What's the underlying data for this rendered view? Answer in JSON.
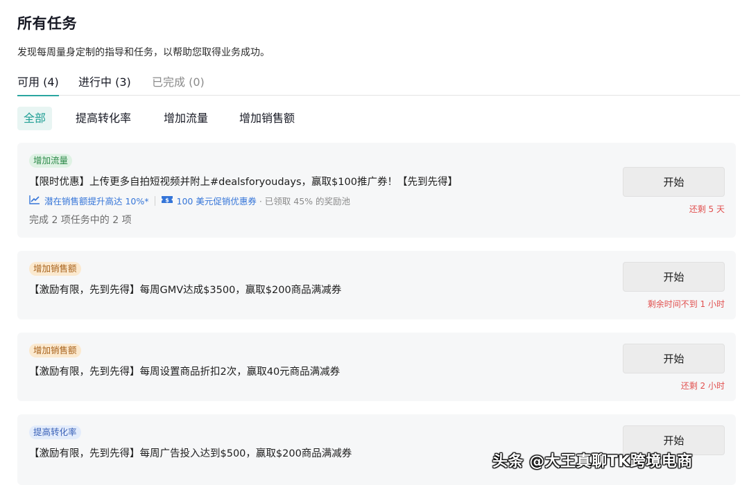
{
  "page": {
    "title": "所有任务",
    "subtitle": "发现每周量身定制的指导和任务，以帮助您取得业务成功。"
  },
  "status_tabs": [
    {
      "label": "可用 (4)",
      "state": "active"
    },
    {
      "label": "进行中 (3)",
      "state": "normal"
    },
    {
      "label": "已完成 (0)",
      "state": "muted"
    }
  ],
  "filters": [
    {
      "label": "全部",
      "active": true
    },
    {
      "label": "提高转化率",
      "active": false
    },
    {
      "label": "增加流量",
      "active": false
    },
    {
      "label": "增加销售额",
      "active": false
    }
  ],
  "tasks": [
    {
      "tag": "增加流量",
      "tag_color": "green",
      "title": "【限时优惠】上传更多自拍短视频并附上#dealsforyoudays，赢取$100推广券！【先到先得】",
      "meta_potential": "潜在销售额提升高达 10%*",
      "meta_coupon": "100 美元促销优惠券",
      "meta_pool": "· 已领取 45% 的奖励池",
      "progress": "完成 2 项任务中的 2 项",
      "button_label": "开始",
      "time_left": "还剩 5 天",
      "icons": [
        "trend-chart-icon",
        "coupon-ticket-icon"
      ]
    },
    {
      "tag": "增加销售额",
      "tag_color": "orange",
      "title": "【激励有限，先到先得】每周GMV达成$3500，赢取$200商品满减券",
      "button_label": "开始",
      "time_left": "剩余时间不到 1 小时"
    },
    {
      "tag": "增加销售额",
      "tag_color": "orange",
      "title": "【激励有限，先到先得】每周设置商品折扣2次，赢取40元商品满减券",
      "button_label": "开始",
      "time_left": "还剩 2 小时"
    },
    {
      "tag": "提高转化率",
      "tag_color": "blue",
      "title": "【激励有限，先到先得】每周广告投入达到$500，赢取$200商品满减券",
      "button_label": "开始"
    }
  ],
  "colors": {
    "accent": "#2aa6a0",
    "link_blue": "#3575d8",
    "warning_red": "#e1504f",
    "card_bg": "#f6f7f8"
  },
  "watermark": "头条 @大王真聊TK跨境电商"
}
